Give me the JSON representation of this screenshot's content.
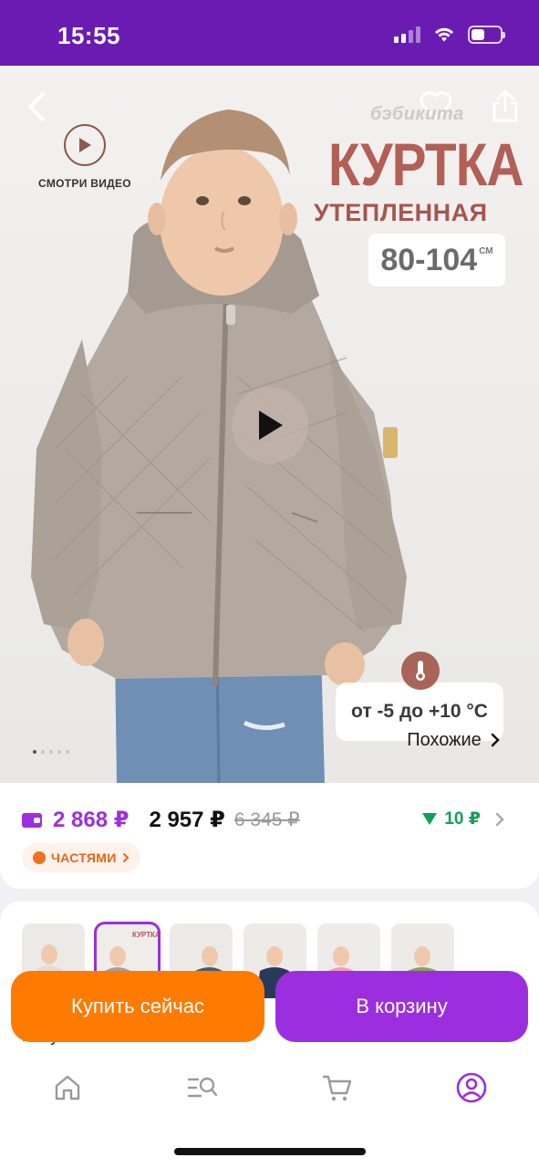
{
  "status_bar": {
    "time": "15:55",
    "battery_level": 0.45
  },
  "hero": {
    "video_cta_label": "СМОТРИ ВИДЕО",
    "brand": "бэбикита",
    "title": "КУРТКА",
    "subtitle": "УТЕПЛЕННАЯ",
    "size_range": "80-104",
    "size_unit": "СМ",
    "temperature": "от -5 до +10 °С",
    "similar_label": "Похожие",
    "image_count": 5,
    "active_image": 0
  },
  "price": {
    "card_price": "2 868 ₽",
    "price": "2 957 ₽",
    "old_price": "6 345 ₽",
    "bonus": "10 ₽",
    "installments_label": "ЧАСТЯМИ"
  },
  "colors": {
    "thumbnails": [
      {
        "label": "beige-variant"
      },
      {
        "label": "grey-variant",
        "text": "КУРТКА"
      },
      {
        "label": "blue-grey-variant"
      },
      {
        "label": "navy-variant"
      },
      {
        "label": "pink-variant"
      },
      {
        "label": "olive-variant"
      }
    ],
    "selected_index": 1,
    "partial_label": "капучино"
  },
  "actions": {
    "buy_now": "Купить сейчас",
    "add_to_cart": "В корзину"
  },
  "tabs": [
    {
      "name": "home-icon"
    },
    {
      "name": "catalog-search-icon"
    },
    {
      "name": "cart-icon"
    },
    {
      "name": "profile-icon",
      "active": true
    }
  ],
  "colors_palette": {
    "primary": "#9b2fe0",
    "status_bar": "#6a1bb2",
    "accent_orange": "#ff7a00",
    "title_brown": "#b25f55",
    "bonus_green": "#12a153"
  }
}
